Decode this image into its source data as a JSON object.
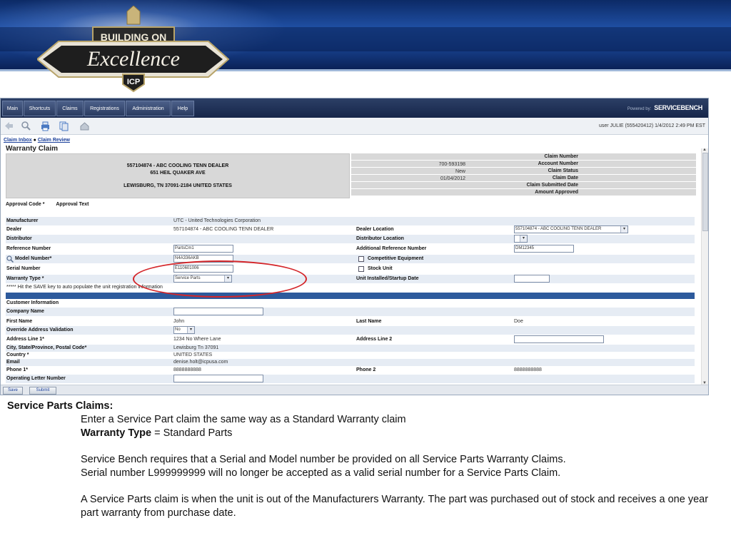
{
  "banner": {
    "line1": "BUILDING ON",
    "line2": "Excellence",
    "badge": "ICP"
  },
  "menu": [
    "Main",
    "Shortcuts",
    "Claims",
    "Registrations",
    "Administration",
    "Help"
  ],
  "powered_by": {
    "prefix": "Powered by:",
    "brand": "SERVICEBENCH"
  },
  "user_info": "user JULIE (555420412) 1/4/2012 2:49 PM EST",
  "breadcrumb": {
    "item1": "Claim Inbox",
    "separator": "●",
    "item2": "Claim Review"
  },
  "page_title": "Warranty Claim",
  "dealer_block": {
    "line1": "557104874 - ABC COOLING TENN DEALER",
    "line2": "651 HEIL QUAKER AVE",
    "line3": "LEWISBURG, TN 37091-2184 UNITED STATES"
  },
  "claim_info": [
    {
      "label": "Claim Number",
      "value": ""
    },
    {
      "label": "Account Number",
      "value": "700-593198"
    },
    {
      "label": "Claim Status",
      "value": "New"
    },
    {
      "label": "Claim Date",
      "value": "01/04/2012"
    },
    {
      "label": "Claim Submitted Date",
      "value": ""
    },
    {
      "label": "Amount Approved",
      "value": ""
    }
  ],
  "approval": {
    "code_label": "Approval Code *",
    "text_label": "Approval Text"
  },
  "form": {
    "manufacturer": {
      "label": "Manufacturer",
      "value": "UTC - United Technologies Corporation"
    },
    "dealer": {
      "label": "Dealer",
      "value": "557104874 - ABC COOLING TENN DEALER"
    },
    "dealer_location": {
      "label": "Dealer Location",
      "value": "557104874 - ABC COOLING TENN DEALER"
    },
    "distributor": {
      "label": "Distributor"
    },
    "distributor_location": {
      "label": "Distributor Location",
      "value": ""
    },
    "reference_number": {
      "label": "Reference Number",
      "value": "PartsCm1"
    },
    "additional_reference": {
      "label": "Additional Reference Number",
      "value": "DM12345"
    },
    "model_number": {
      "label": "Model Number*",
      "value": "N4A336AKB"
    },
    "competitive_equipment": {
      "label": "Competitive Equipment"
    },
    "serial_number": {
      "label": "Serial Number",
      "value": "E110601006"
    },
    "stock_unit": {
      "label": "Stock Unit"
    },
    "warranty_type": {
      "label": "Warranty Type *",
      "value": "Service Parts"
    },
    "unit_installed": {
      "label": "Unit Installed/Startup Date",
      "value": ""
    },
    "hint": "***** Hit the SAVE key to auto populate the unit registration information",
    "customer_info": {
      "label": "Customer Information"
    },
    "company_name": {
      "label": "Company Name",
      "value": ""
    },
    "first_name": {
      "label": "First Name",
      "value": "John"
    },
    "last_name": {
      "label": "Last Name",
      "value": "Doe"
    },
    "override_address": {
      "label": "Override Address Validation",
      "value": "No"
    },
    "address_line1": {
      "label": "Address Line 1*",
      "value": "1234 No Where Lane"
    },
    "address_line2": {
      "label": "Address Line 2",
      "value": ""
    },
    "city_state": {
      "label": "City, State/Province, Postal Code*",
      "value": "Lewisburg   Tn   37091"
    },
    "country": {
      "label": "Country *",
      "value": "UNITED STATES"
    },
    "email": {
      "label": "Email",
      "value": "denise.holt@icpusa.com"
    },
    "phone1": {
      "label": "Phone 1*",
      "value": "8888888888"
    },
    "phone2": {
      "label": "Phone 2",
      "value": "8888888888"
    },
    "operating_letter": {
      "label": "Operating Letter Number",
      "value": ""
    }
  },
  "buttons": {
    "save": "Save",
    "submit": "Submit"
  },
  "notes": {
    "title": "Service Parts Claims:",
    "line1": "Enter a  Service Part claim the same way as a Standard Warranty claim",
    "line2_bold": "Warranty Type",
    "line2_rest": " = Standard Parts",
    "line3": "Service Bench requires that a Serial and Model number be provided on all Service Parts Warranty Claims.",
    "line4": "Serial number L999999999 will no longer be accepted as a valid serial number for a Service Parts Claim.",
    "line5": "A Service Parts claim is when the unit is out of  the Manufacturers Warranty. The part was purchased out of stock and receives a one year part warranty from purchase date."
  },
  "colors": {
    "menu_bg": "#1d2e52",
    "section_bar": "#2d5a9c",
    "highlight_oval": "#d4262a",
    "link": "#1a3f9a"
  }
}
